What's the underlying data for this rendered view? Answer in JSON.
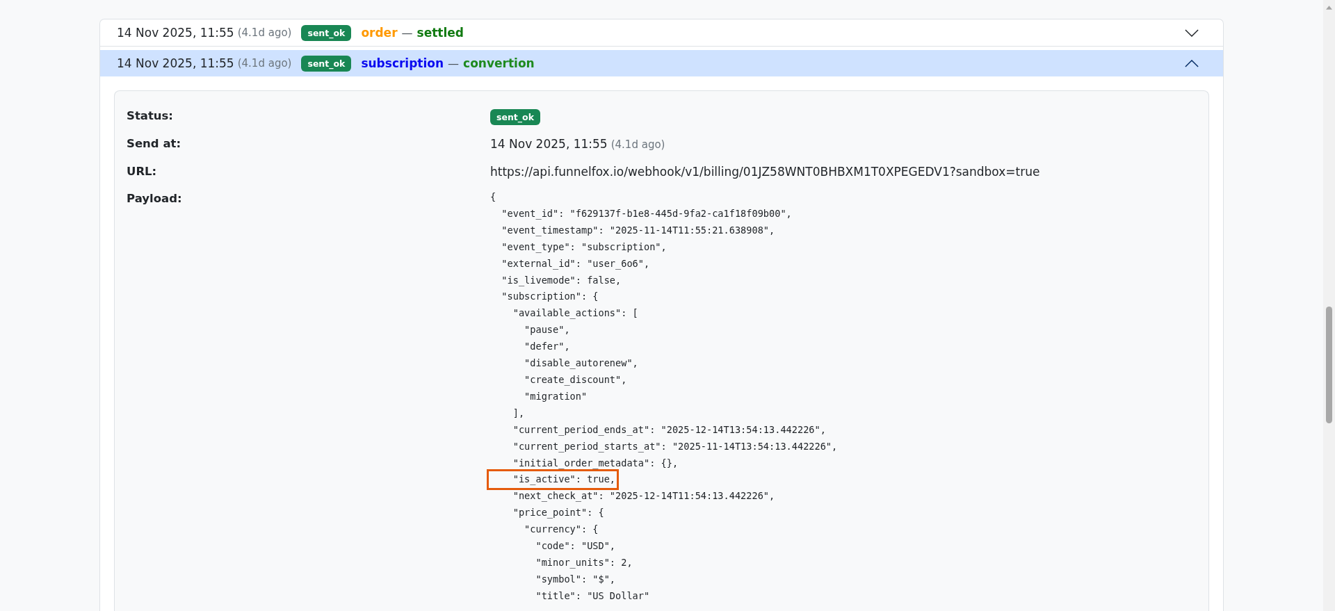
{
  "events": [
    {
      "time": "14 Nov 2025, 11:55",
      "ago": "(4.1d ago)",
      "status": "sent_ok",
      "object": {
        "text": "order",
        "color": "#ff9900"
      },
      "separator": "—",
      "event": {
        "text": "settled",
        "color": "#117a11"
      },
      "expanded": false
    },
    {
      "time": "14 Nov 2025, 11:55",
      "ago": "(4.1d ago)",
      "status": "sent_ok",
      "object": {
        "text": "subscription",
        "color": "#0a0af0"
      },
      "separator": "—",
      "event": {
        "text": "convertion",
        "color": "#1e8a1e"
      },
      "expanded": true,
      "details": {
        "status_label": "Status:",
        "status": "sent_ok",
        "send_label": "Send at:",
        "send_time": "14 Nov 2025, 11:55",
        "send_ago": "(4.1d ago)",
        "url_label": "URL:",
        "url": "https://api.funnelfox.io/webhook/v1/billing/01JZ58WNT0BHBXM1T0XPEGEDV1?sandbox=true",
        "payload_label": "Payload:",
        "payload": [
          {
            "text": "{",
            "highlighted": false
          },
          {
            "text": "  \"event_id\": \"f629137f-b1e8-445d-9fa2-ca1f18f09b00\",",
            "highlighted": false
          },
          {
            "text": "  \"event_timestamp\": \"2025-11-14T11:55:21.638908\",",
            "highlighted": false
          },
          {
            "text": "  \"event_type\": \"subscription\",",
            "highlighted": false
          },
          {
            "text": "  \"external_id\": \"user_6o6\",",
            "highlighted": false
          },
          {
            "text": "  \"is_livemode\": false,",
            "highlighted": false
          },
          {
            "text": "  \"subscription\": {",
            "highlighted": false
          },
          {
            "text": "    \"available_actions\": [",
            "highlighted": false
          },
          {
            "text": "      \"pause\",",
            "highlighted": false
          },
          {
            "text": "      \"defer\",",
            "highlighted": false
          },
          {
            "text": "      \"disable_autorenew\",",
            "highlighted": false
          },
          {
            "text": "      \"create_discount\",",
            "highlighted": false
          },
          {
            "text": "      \"migration\"",
            "highlighted": false
          },
          {
            "text": "    ],",
            "highlighted": false
          },
          {
            "text": "    \"current_period_ends_at\": \"2025-12-14T13:54:13.442226\",",
            "highlighted": false
          },
          {
            "text": "    \"current_period_starts_at\": \"2025-11-14T13:54:13.442226\",",
            "highlighted": false
          },
          {
            "text": "    \"initial_order_metadata\": {},",
            "highlighted": false
          },
          {
            "text": "    \"is_active\": true,",
            "highlighted": true
          },
          {
            "text": "    \"next_check_at\": \"2025-12-14T11:54:13.442226\",",
            "highlighted": false
          },
          {
            "text": "    \"price_point\": {",
            "highlighted": false
          },
          {
            "text": "      \"currency\": {",
            "highlighted": false
          },
          {
            "text": "        \"code\": \"USD\",",
            "highlighted": false
          },
          {
            "text": "        \"minor_units\": 2,",
            "highlighted": false
          },
          {
            "text": "        \"symbol\": \"$\",",
            "highlighted": false
          },
          {
            "text": "        \"title\": \"US Dollar\"",
            "highlighted": false
          }
        ]
      }
    }
  ]
}
